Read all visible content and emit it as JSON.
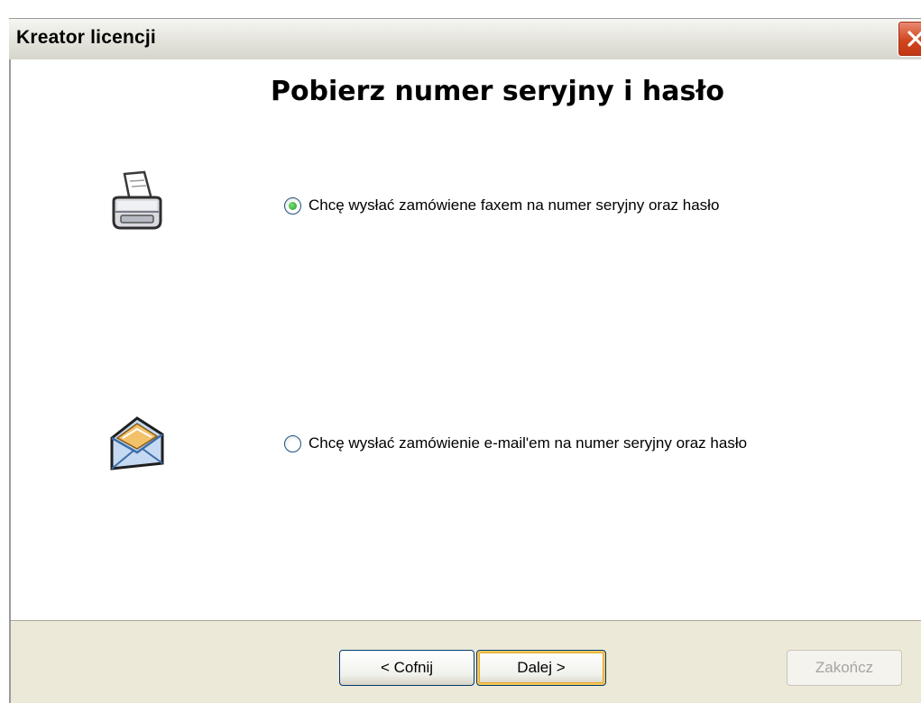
{
  "window": {
    "title": "Kreator licencji"
  },
  "page": {
    "heading": "Pobierz numer seryjny i hasło"
  },
  "options": {
    "fax": {
      "label": "Chcę wysłać zamówiene faxem na numer seryjny oraz hasło",
      "selected": true,
      "icon": "printer-fax-icon"
    },
    "email": {
      "label": "Chcę wysłać zamówienie e-mail'em  na numer seryjny oraz hasło",
      "selected": false,
      "icon": "mail-envelope-icon"
    }
  },
  "buttons": {
    "back": "< Cofnij",
    "next": "Dalej >",
    "finish": "Zakończ"
  },
  "colors": {
    "footer_bg": "#ece9d8",
    "close_button": "#d2451f",
    "radio_checked": "#1f9b1f"
  }
}
